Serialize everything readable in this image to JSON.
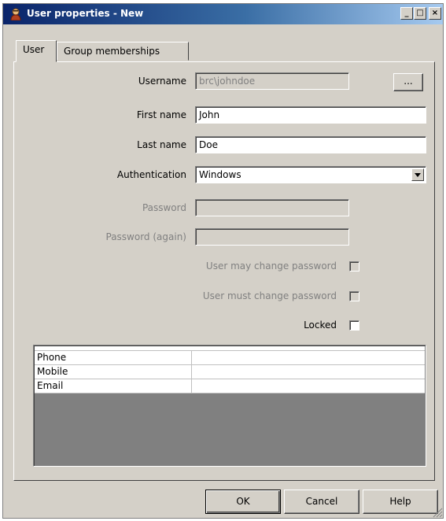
{
  "window": {
    "title": "User properties - New",
    "minimize_glyph": "_",
    "maximize_glyph": "□",
    "close_glyph": "×"
  },
  "tabs": [
    {
      "label": "User",
      "active": true
    },
    {
      "label": "Group memberships",
      "active": false
    }
  ],
  "form": {
    "username": {
      "label": "Username",
      "value": "brc\\johndoe",
      "browse_label": "..."
    },
    "first_name": {
      "label": "First name",
      "value": "John"
    },
    "last_name": {
      "label": "Last name",
      "value": "Doe"
    },
    "authentication": {
      "label": "Authentication",
      "value": "Windows"
    },
    "password": {
      "label": "Password",
      "value": ""
    },
    "password_again": {
      "label": "Password (again)",
      "value": ""
    },
    "user_may_change": {
      "label": "User may change password",
      "checked": false
    },
    "user_must_change": {
      "label": "User must change password",
      "checked": false
    },
    "locked": {
      "label": "Locked",
      "checked": false
    }
  },
  "properties_table": {
    "rows": [
      {
        "key": "Phone",
        "value": ""
      },
      {
        "key": "Mobile",
        "value": ""
      },
      {
        "key": "Email",
        "value": ""
      }
    ]
  },
  "buttons": {
    "ok": "OK",
    "cancel": "Cancel",
    "help": "Help"
  }
}
